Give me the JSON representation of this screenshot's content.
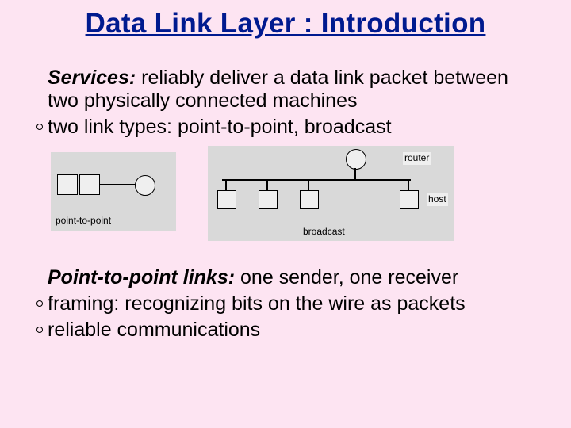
{
  "title": "Data Link Layer : Introduction",
  "services": {
    "lead": "Services:",
    "text": " reliably deliver a data link packet between two physically connected machines",
    "bullet1": "two link types: point-to-point, broadcast"
  },
  "diagram": {
    "p2p_label": "point-to-point",
    "router_label": "router",
    "host_label": "host",
    "broadcast_label": "broadcast"
  },
  "p2p": {
    "lead": "Point-to-point links:",
    "text": " one sender, one receiver",
    "bullet1a": "framing:",
    "bullet1b": " recognizing bits on the wire as packets",
    "bullet2": "reliable communications"
  }
}
